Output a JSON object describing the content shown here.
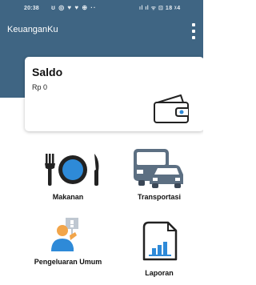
{
  "status_bar": {
    "time": "20:38",
    "left_icons": "ʊ ◎ ♥ ♥ ⊕ ··",
    "right_icons": "ıl ıl ᯤ ⊡ 18 ᵡ4"
  },
  "app": {
    "title": "KeuanganKu"
  },
  "balance_card": {
    "title": "Saldo",
    "amount": "Rp 0"
  },
  "menu": [
    {
      "label": "Makanan",
      "icon": "food-plate-icon"
    },
    {
      "label": "Transportasi",
      "icon": "vehicles-icon"
    },
    {
      "label": "Pengeluaran Umum",
      "icon": "person-expense-icon"
    },
    {
      "label": "Laporan",
      "icon": "report-chart-icon"
    }
  ],
  "colors": {
    "header": "#3f6583",
    "accent_blue": "#2e8ad8",
    "vehicle_slate": "#5c6f82"
  }
}
